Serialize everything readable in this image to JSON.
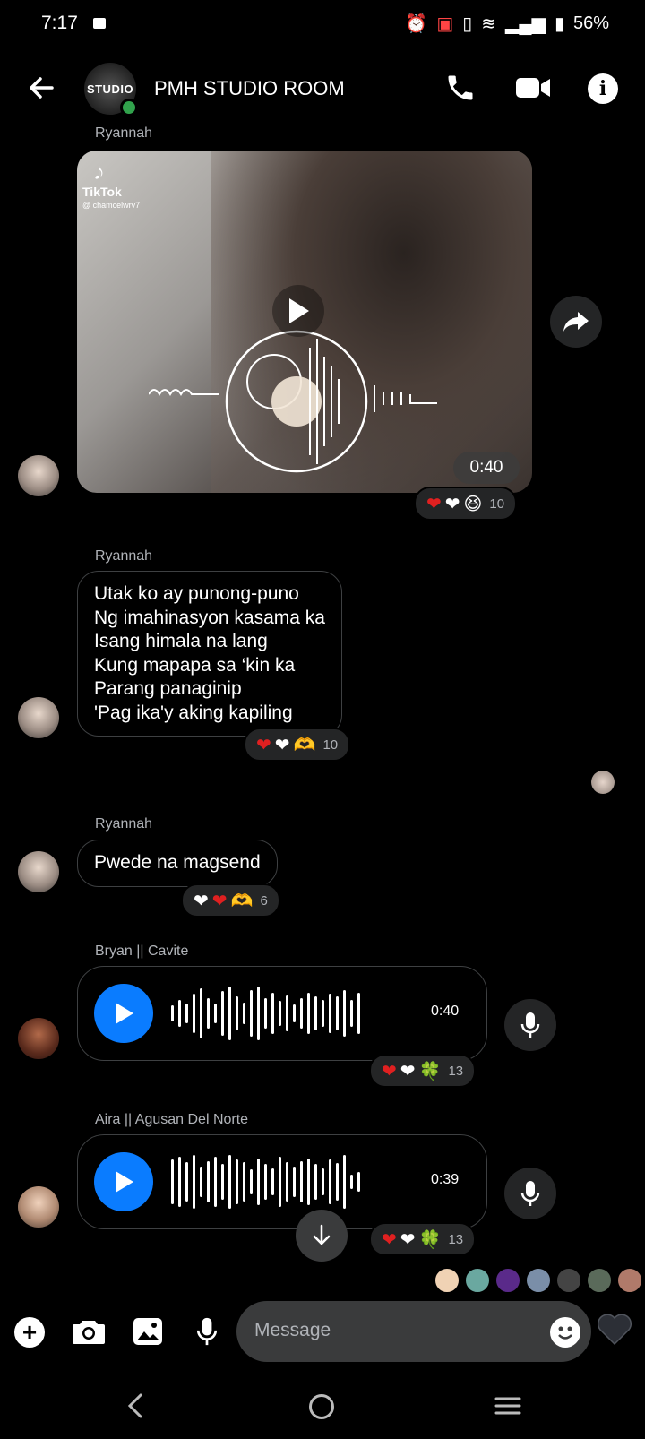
{
  "status": {
    "time": "7:17",
    "battery": "56%"
  },
  "header": {
    "title": "PMH STUDIO ROOM",
    "group_avatar_text": "STUDIO"
  },
  "video": {
    "sender": "Ryannah",
    "duration": "0:40",
    "watermark_brand": "TikTok",
    "watermark_user": "@ chamcelwrv7",
    "reaction_count": "10"
  },
  "lyrics": {
    "sender": "Ryannah",
    "lines": [
      "Utak ko ay punong-puno",
      "Ng imahinasyon kasama ka",
      "Isang himala na lang",
      "Kung mapapa sa ‘kin ka",
      "Parang panaginip",
      "'Pag ika'y aking kapiling"
    ],
    "reaction_count": "10"
  },
  "pwede": {
    "sender": "Ryannah",
    "text": "Pwede na magsend",
    "reaction_count": "6"
  },
  "voice1": {
    "sender": "Bryan || Cavite",
    "duration": "0:40",
    "reaction_count": "13"
  },
  "voice2": {
    "sender": "Aira || Agusan Del Norte",
    "duration": "0:39",
    "reaction_count": "13"
  },
  "composer": {
    "placeholder": "Message"
  },
  "colors": {
    "accent": "#0a7cff",
    "online": "#31a24c",
    "bubble_border": "#3e4042"
  }
}
